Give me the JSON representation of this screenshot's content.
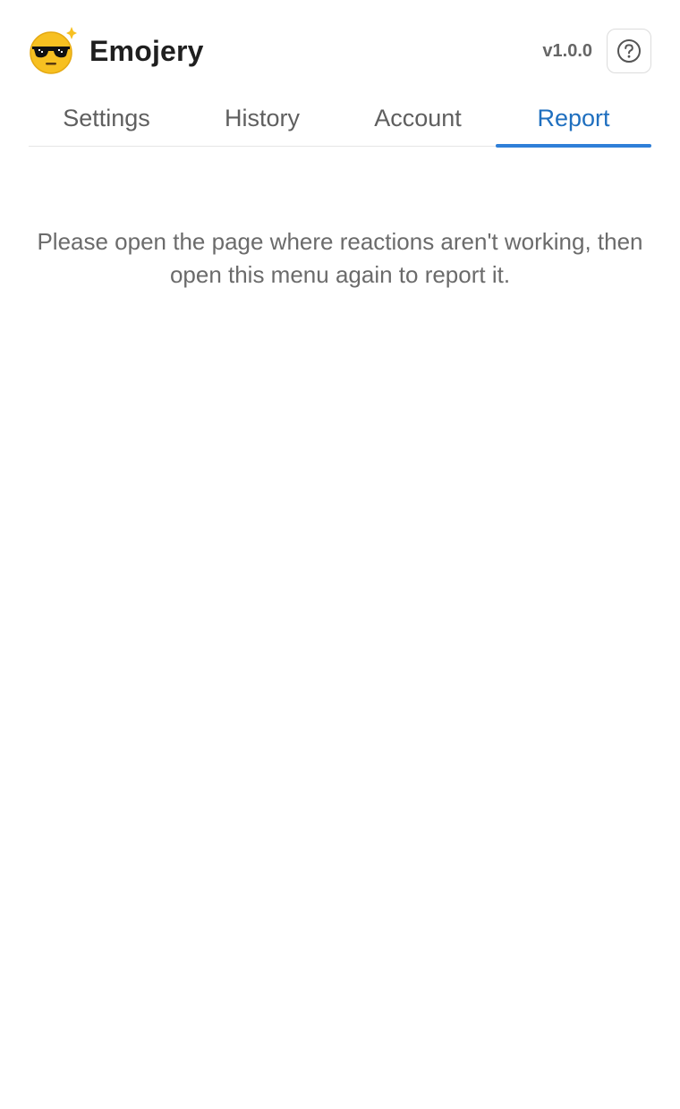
{
  "header": {
    "app_name": "Emojery",
    "version": "v1.0.0",
    "logo_icon": "sunglasses-emoji-icon",
    "help_icon": "question-circle-icon"
  },
  "tabs": [
    {
      "label": "Settings",
      "active": false
    },
    {
      "label": "History",
      "active": false
    },
    {
      "label": "Account",
      "active": false
    },
    {
      "label": "Report",
      "active": true
    }
  ],
  "report": {
    "message": "Please open the page where reactions aren't working, then open this menu again to report it."
  },
  "colors": {
    "accent": "#2f7fd8",
    "active_tab_text": "#1f6fbf",
    "muted_text": "#6b6b6b",
    "logo_yellow": "#f7c021"
  }
}
